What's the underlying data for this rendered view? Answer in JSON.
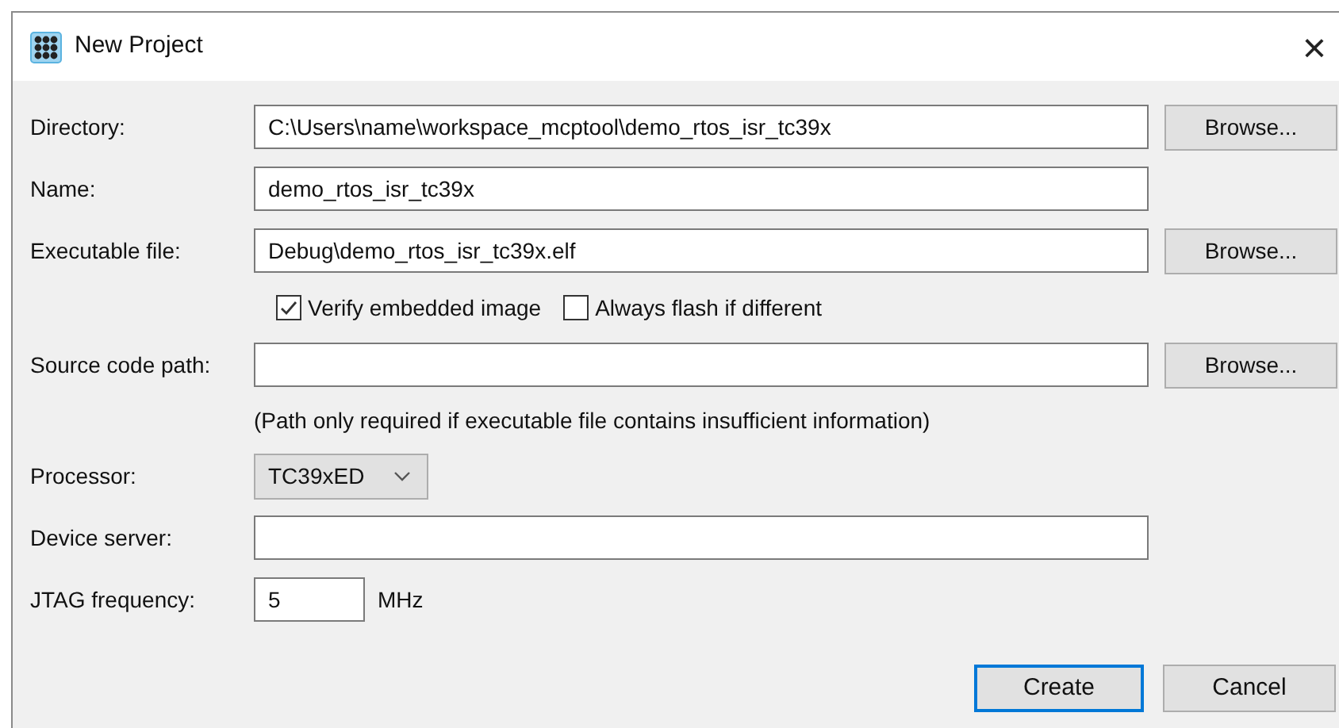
{
  "window": {
    "title": "New Project",
    "close": "×"
  },
  "rows": [
    {
      "kind": "text",
      "label": "Directory:",
      "value": "C:\\Users\\name\\workspace_mcptool\\demo_rtos_isr_tc39x",
      "button": "Browse..."
    },
    {
      "kind": "text",
      "label": "Name:",
      "value": "demo_rtos_isr_tc39x"
    },
    {
      "kind": "text",
      "label": "Executable file:",
      "value": "Debug\\demo_rtos_isr_tc39x.elf",
      "button": "Browse..."
    },
    {
      "kind": "checks",
      "checks": [
        {
          "label": "Verify embedded image",
          "checked": true
        },
        {
          "label": "Always flash if different",
          "checked": false
        }
      ]
    },
    {
      "kind": "text",
      "label": "Source code path:",
      "value": "",
      "button": "Browse..."
    },
    {
      "kind": "note",
      "text": "(Path only required if executable file contains insufficient information)"
    },
    {
      "kind": "select",
      "label": "Processor:",
      "value": "TC39xED"
    },
    {
      "kind": "text",
      "label": "Device server:",
      "value": ""
    },
    {
      "kind": "number",
      "label": "JTAG frequency:",
      "value": "5",
      "unit": "MHz"
    }
  ],
  "buttons": [
    {
      "label": "Create",
      "default": true
    },
    {
      "label": "Cancel",
      "default": false
    }
  ]
}
